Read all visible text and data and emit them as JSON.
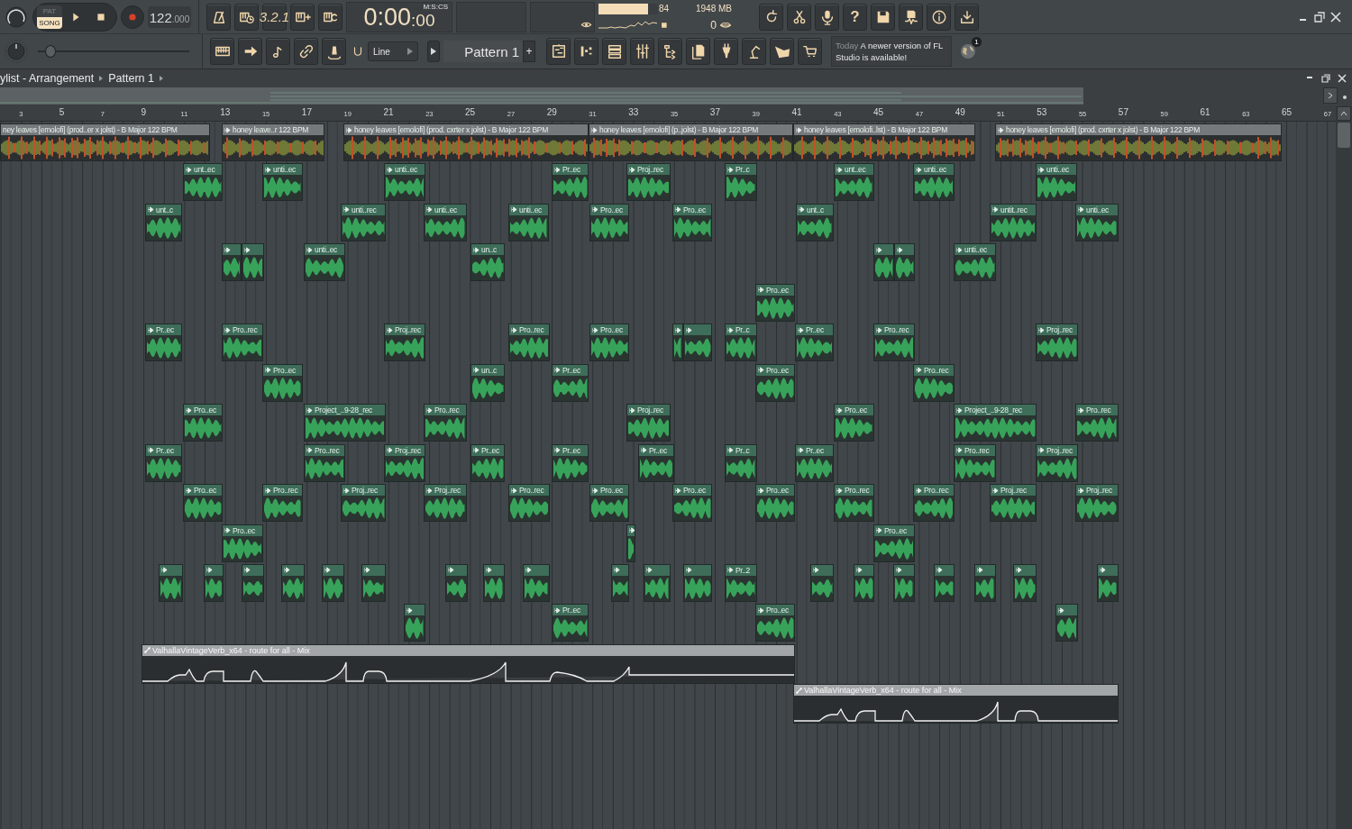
{
  "transport": {
    "mode_options": [
      {
        "label": "PAT",
        "selected": false
      },
      {
        "label": "SONG",
        "selected": true
      }
    ],
    "tempo": "122",
    "tempo_decimals": ".000",
    "countdown": "3.2.1"
  },
  "time": {
    "main": "0:00",
    "sub": ":00",
    "format": "M:S:CS"
  },
  "monitor": {
    "cpu": {
      "level": 0.84,
      "reading": "84"
    },
    "memory": "1948 MB",
    "polyphony": "0"
  },
  "pitch_slider": {
    "level": 0.05
  },
  "snap": {
    "value": "Line"
  },
  "pattern": {
    "name": "Pattern 1",
    "add": "+"
  },
  "help": "?",
  "news": {
    "date": "Today",
    "message": "A newer version of FL Studio is available!",
    "badge": "1"
  },
  "playlist": {
    "title": "ylist - Arrangement",
    "breadcrumb": "Pattern 1",
    "ruler": [
      {
        "label": "3",
        "major": false
      },
      {
        "label": "5",
        "major": true
      },
      {
        "label": "7",
        "major": false
      },
      {
        "label": "9",
        "major": true
      },
      {
        "label": "11",
        "major": false
      },
      {
        "label": "13",
        "major": true
      },
      {
        "label": "15",
        "major": false
      },
      {
        "label": "17",
        "major": true
      },
      {
        "label": "19",
        "major": false
      },
      {
        "label": "21",
        "major": true
      },
      {
        "label": "23",
        "major": false
      },
      {
        "label": "25",
        "major": true
      },
      {
        "label": "27",
        "major": false
      },
      {
        "label": "29",
        "major": true
      },
      {
        "label": "31",
        "major": false
      },
      {
        "label": "33",
        "major": true
      },
      {
        "label": "35",
        "major": false
      },
      {
        "label": "37",
        "major": true
      },
      {
        "label": "39",
        "major": false
      },
      {
        "label": "41",
        "major": true
      },
      {
        "label": "43",
        "major": false
      },
      {
        "label": "45",
        "major": true
      },
      {
        "label": "47",
        "major": false
      },
      {
        "label": "49",
        "major": true
      },
      {
        "label": "51",
        "major": false
      },
      {
        "label": "53",
        "major": true
      },
      {
        "label": "55",
        "major": false
      },
      {
        "label": "57",
        "major": true
      },
      {
        "label": "59",
        "major": false
      },
      {
        "label": "61",
        "major": true
      },
      {
        "label": "63",
        "major": false
      },
      {
        "label": "65",
        "major": true
      },
      {
        "label": "67",
        "major": false
      }
    ],
    "tracks": [
      {
        "clips": [
          {
            "kind": "song",
            "label": "ney leaves [emolofi] (prod..er x jolst) - B Major 122 BPM"
          },
          {
            "kind": "song",
            "label": "honey leave..r 122 BPM"
          },
          {
            "kind": "song",
            "label": "honey leaves [emolofi] (prod. cxrter x jolst) - B Major 122 BPM"
          },
          {
            "kind": "song",
            "label": "honey leaves [emolofi] (p..jolst) - B Major 122 BPM"
          },
          {
            "kind": "song",
            "label": "honey leaves [emolofi..lst) - B Major 122 BPM"
          },
          {
            "kind": "song",
            "label": "honey leaves [emolofi] (prod. cxrter x jolst) - B Major 122 BPM"
          }
        ]
      },
      {
        "clips": [
          {
            "kind": "audio",
            "label": "unt..ec"
          },
          {
            "kind": "audio",
            "label": "unti..ec"
          },
          {
            "kind": "audio",
            "label": "unti..ec"
          },
          {
            "kind": "audio",
            "label": "Pr..ec"
          },
          {
            "kind": "audio",
            "label": "Proj..rec"
          },
          {
            "kind": "audio",
            "label": "Pr..c"
          },
          {
            "kind": "audio",
            "label": "unt..ec"
          },
          {
            "kind": "audio",
            "label": "unti..ec"
          },
          {
            "kind": "audio",
            "label": "unti..ec"
          }
        ]
      },
      {
        "clips": [
          {
            "kind": "audio",
            "label": "unt..c"
          },
          {
            "kind": "audio",
            "label": "unti..rec"
          },
          {
            "kind": "audio",
            "label": "unti..ec"
          },
          {
            "kind": "audio",
            "label": "unti..ec"
          },
          {
            "kind": "audio",
            "label": "Pro..ec"
          },
          {
            "kind": "audio",
            "label": "Pro..ec"
          },
          {
            "kind": "audio",
            "label": "unt..c"
          },
          {
            "kind": "audio",
            "label": "untit..rec"
          },
          {
            "kind": "audio",
            "label": "unti..ec"
          }
        ]
      },
      {
        "clips": [
          {
            "kind": "audio"
          },
          {
            "kind": "audio"
          },
          {
            "kind": "audio",
            "label": "unti..ec"
          },
          {
            "kind": "audio",
            "label": "un..c"
          },
          {
            "kind": "audio"
          },
          {
            "kind": "audio"
          },
          {
            "kind": "audio",
            "label": "unti..ec"
          }
        ]
      },
      {
        "clips": [
          {
            "kind": "audio",
            "label": "Pro..ec"
          }
        ]
      },
      {
        "clips": [
          {
            "kind": "audio",
            "label": "Pr..ec"
          },
          {
            "kind": "audio",
            "label": "Pro..rec"
          },
          {
            "kind": "audio",
            "label": "Proj..rec"
          },
          {
            "kind": "audio",
            "label": "Pro..rec"
          },
          {
            "kind": "audio",
            "label": "Pro..ec"
          },
          {
            "kind": "audio"
          },
          {
            "kind": "audio"
          },
          {
            "kind": "audio",
            "label": "Pr..c"
          },
          {
            "kind": "audio",
            "label": "Pr..ec"
          },
          {
            "kind": "audio",
            "label": "Pro..rec"
          },
          {
            "kind": "audio",
            "label": "Proj..rec"
          }
        ]
      },
      {
        "clips": [
          {
            "kind": "audio",
            "label": "Pro..ec"
          },
          {
            "kind": "audio",
            "label": "un..c"
          },
          {
            "kind": "audio",
            "label": "Pr..ec"
          },
          {
            "kind": "audio",
            "label": "Pro..ec"
          },
          {
            "kind": "audio",
            "label": "Pro..rec"
          }
        ]
      },
      {
        "clips": [
          {
            "kind": "audio",
            "label": "Pro..ec"
          },
          {
            "kind": "audio",
            "label": "Project_..9-28_rec"
          },
          {
            "kind": "audio",
            "label": "Pro..rec"
          },
          {
            "kind": "audio",
            "label": "Proj..rec"
          },
          {
            "kind": "audio",
            "label": "Pro..ec"
          },
          {
            "kind": "audio",
            "label": "Project_..9-28_rec"
          },
          {
            "kind": "audio",
            "label": "Pro..rec"
          }
        ]
      },
      {
        "clips": [
          {
            "kind": "audio",
            "label": "Pr..ec"
          },
          {
            "kind": "audio",
            "label": "Pro..rec"
          },
          {
            "kind": "audio",
            "label": "Proj..rec"
          },
          {
            "kind": "audio",
            "label": "Pr..ec"
          },
          {
            "kind": "audio",
            "label": "Pr..ec"
          },
          {
            "kind": "audio",
            "label": "Pr..ec"
          },
          {
            "kind": "audio",
            "label": "Pr..c"
          },
          {
            "kind": "audio",
            "label": "Pr..ec"
          },
          {
            "kind": "audio",
            "label": "Pro..rec"
          },
          {
            "kind": "audio",
            "label": "Proj..rec"
          }
        ]
      },
      {
        "clips": [
          {
            "kind": "audio",
            "label": "Pro..ec"
          },
          {
            "kind": "audio",
            "label": "Pro..rec"
          },
          {
            "kind": "audio",
            "label": "Proj..rec"
          },
          {
            "kind": "audio",
            "label": "Proj..rec"
          },
          {
            "kind": "audio",
            "label": "Pro..rec"
          },
          {
            "kind": "audio",
            "label": "Pro..ec"
          },
          {
            "kind": "audio",
            "label": "Pro..ec"
          },
          {
            "kind": "audio",
            "label": "Pro..ec"
          },
          {
            "kind": "audio",
            "label": "Pro..rec"
          },
          {
            "kind": "audio",
            "label": "Pro..rec"
          },
          {
            "kind": "audio",
            "label": "Proj..rec"
          },
          {
            "kind": "audio",
            "label": "Proj..rec"
          }
        ]
      },
      {
        "clips": [
          {
            "kind": "audio",
            "label": "Pro..ec"
          },
          {
            "kind": "audio"
          },
          {
            "kind": "audio",
            "label": "Pro..ec"
          }
        ]
      },
      {
        "clips": [
          {
            "kind": "audio"
          },
          {
            "kind": "audio"
          },
          {
            "kind": "audio"
          },
          {
            "kind": "audio"
          },
          {
            "kind": "audio"
          },
          {
            "kind": "audio"
          },
          {
            "kind": "audio"
          },
          {
            "kind": "audio"
          },
          {
            "kind": "audio"
          },
          {
            "kind": "audio"
          },
          {
            "kind": "audio"
          },
          {
            "kind": "audio"
          },
          {
            "kind": "audio",
            "label": "Pr..2"
          },
          {
            "kind": "audio"
          },
          {
            "kind": "audio"
          },
          {
            "kind": "audio"
          },
          {
            "kind": "audio"
          },
          {
            "kind": "audio"
          },
          {
            "kind": "audio"
          },
          {
            "kind": "audio"
          }
        ]
      },
      {
        "clips": [
          {
            "kind": "audio"
          },
          {
            "kind": "audio",
            "label": "Pr..ec"
          },
          {
            "kind": "audio",
            "label": "Pro..ec"
          },
          {
            "kind": "audio"
          }
        ]
      },
      {
        "clips": [
          {
            "kind": "automation",
            "label": "ValhallaVintageVerb_x64 - route for all - Mix"
          }
        ]
      },
      {
        "clips": [
          {
            "kind": "automation",
            "label": "ValhallaVintageVerb_x64 - route for all - Mix"
          }
        ]
      }
    ]
  }
}
